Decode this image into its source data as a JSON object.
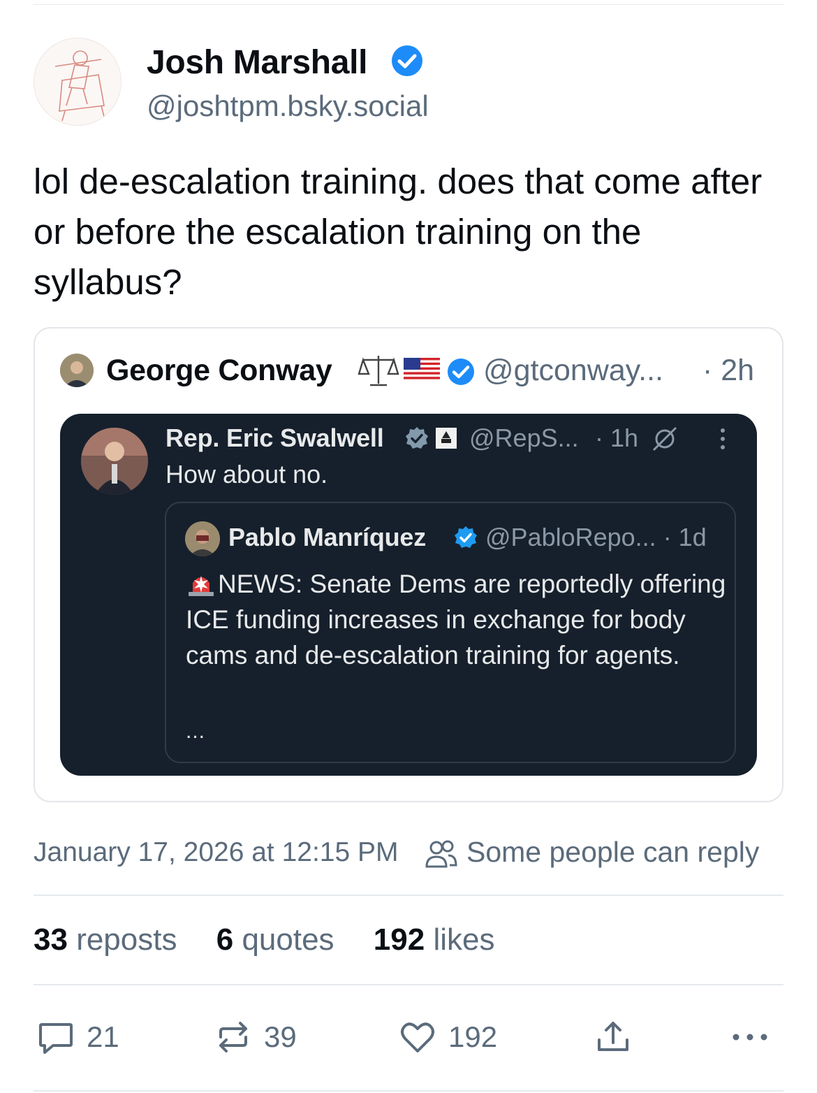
{
  "post": {
    "author_name": "Josh Marshall",
    "author_handle": "@joshtpm.bsky.social",
    "text": "lol de-escalation training. does that come after or before the escalation training on the syllabus?",
    "timestamp": "January 17, 2026 at 12:15 PM",
    "reply_setting": "Some people can reply"
  },
  "quote": {
    "author_name": "George Conway",
    "emojis": [
      "scales-emoji",
      "us-flag-emoji"
    ],
    "handle": "@gtconway...",
    "time": "· 2h",
    "embedded": {
      "author_name": "Rep. Eric Swalwell",
      "handle": "@RepS...",
      "time": "· 1h",
      "text": "How about no.",
      "inner": {
        "author_name": "Pablo Manríquez",
        "handle": "@PabloRepo... · 1d",
        "text": "NEWS: Senate Dems are reportedly offering ICE funding increases in exchange for body cams and de-escalation training for agents.",
        "ellipsis": "..."
      }
    }
  },
  "stats": {
    "reposts_count": "33",
    "reposts_label": "reposts",
    "quotes_count": "6",
    "quotes_label": "quotes",
    "likes_count": "192",
    "likes_label": "likes"
  },
  "actions": {
    "reply_count": "21",
    "repost_count": "39",
    "like_count": "192"
  },
  "colors": {
    "verified_blue": "#1d8cf8",
    "muted_text": "#5b6b7b",
    "dark_embed_bg": "#16202c"
  }
}
